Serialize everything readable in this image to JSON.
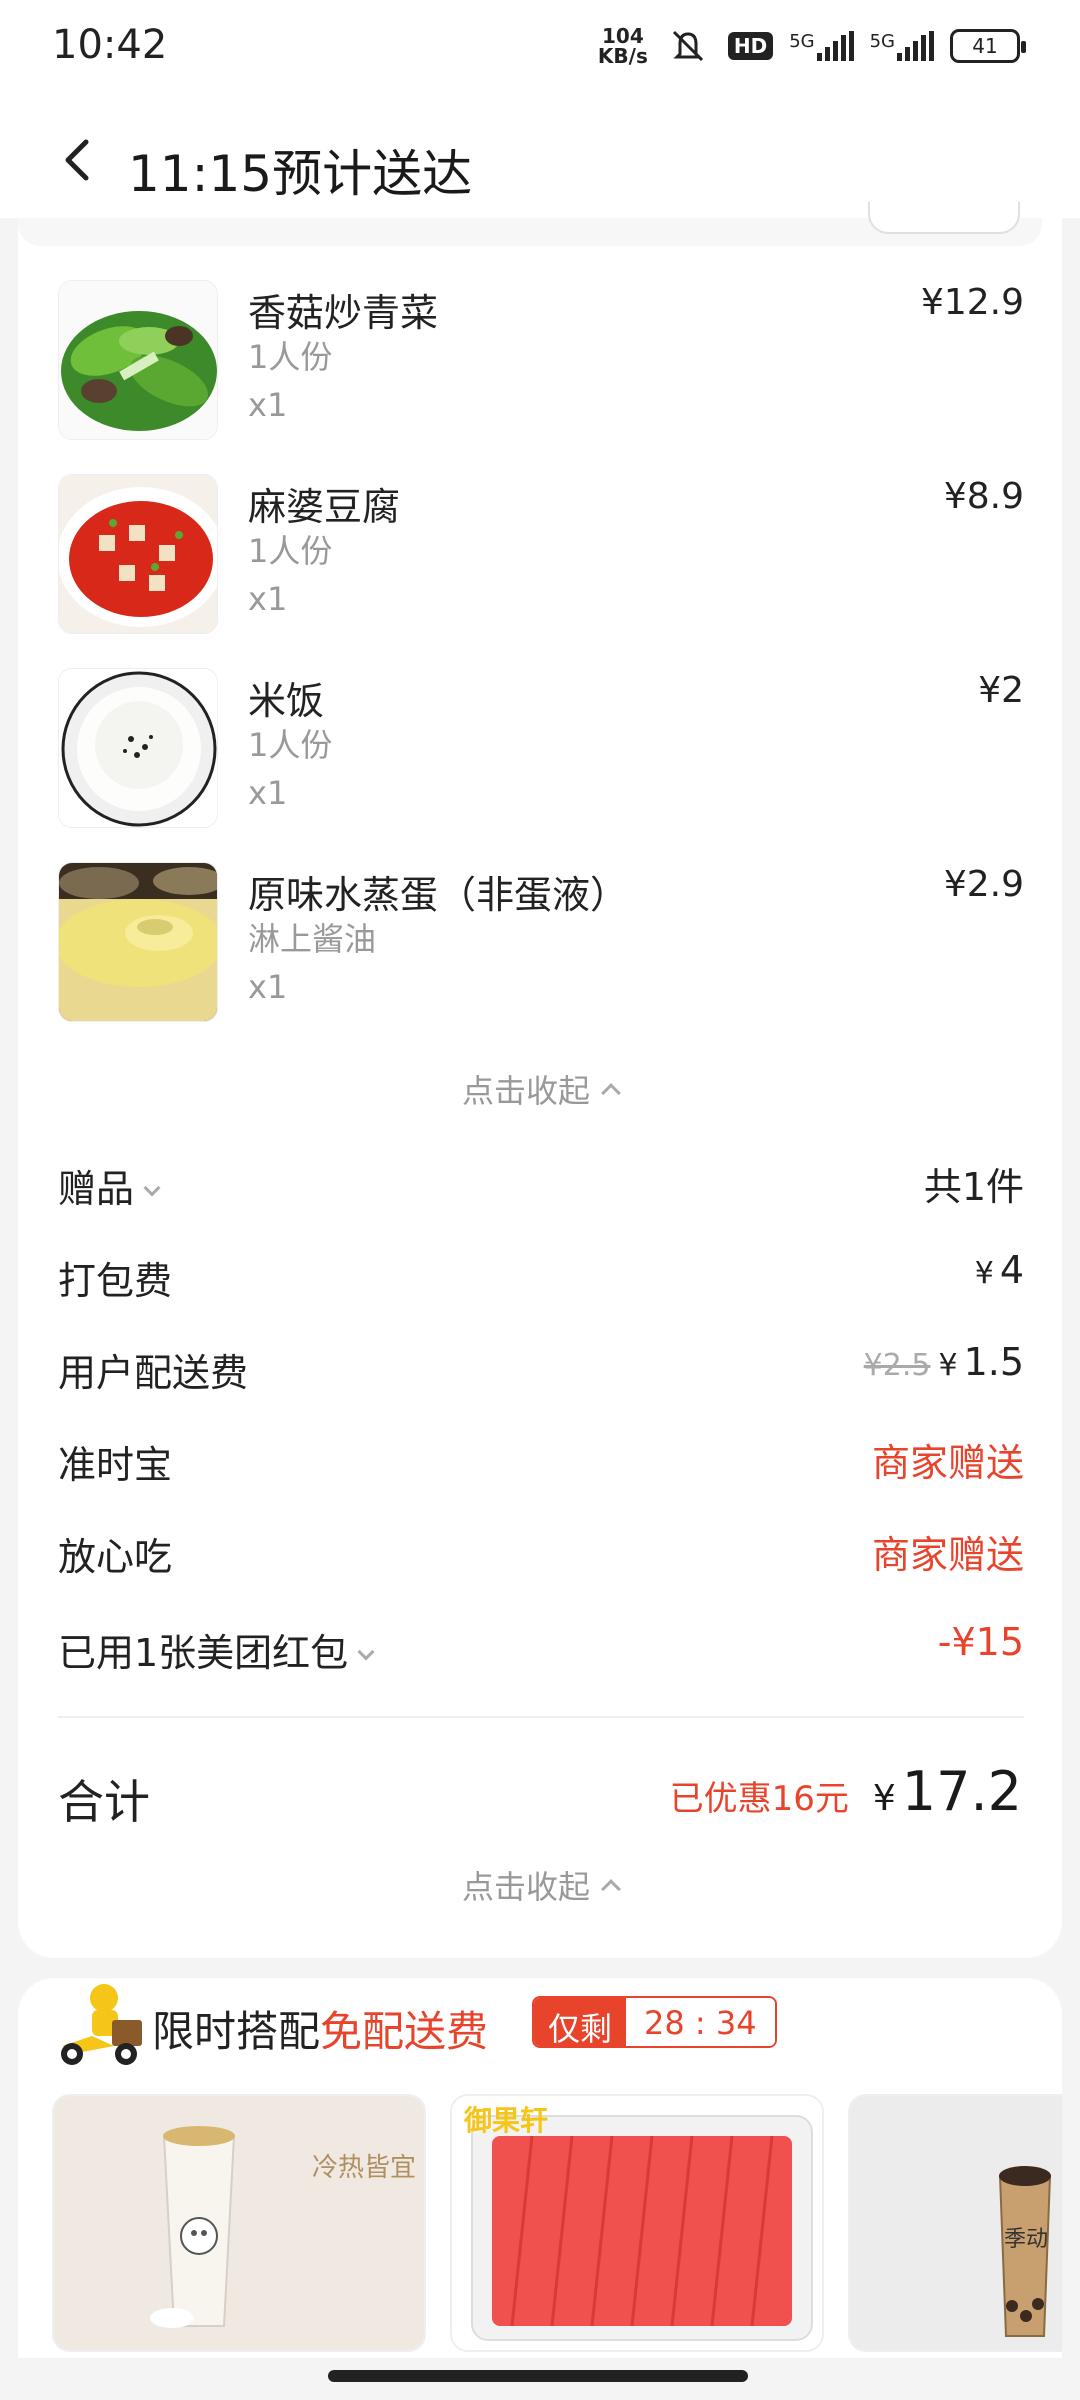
{
  "status_bar": {
    "time": "10:42",
    "net_speed_value": "104",
    "net_speed_unit": "KB/s",
    "hd_label": "HD",
    "signal1_label": "5G",
    "signal2_label": "5G",
    "battery": "41"
  },
  "header": {
    "title": "11:15预计送达"
  },
  "items": [
    {
      "name": "香菇炒青菜",
      "spec": "1人份",
      "qty": "x1",
      "price": "¥12.9"
    },
    {
      "name": "麻婆豆腐",
      "spec": "1人份",
      "qty": "x1",
      "price": "¥8.9"
    },
    {
      "name": "米饭",
      "spec": "1人份",
      "qty": "x1",
      "price": "¥2"
    },
    {
      "name": "原味水蒸蛋（非蛋液）",
      "spec": "淋上酱油",
      "qty": "x1",
      "price": "¥2.9"
    }
  ],
  "collapse_label": "点击收起",
  "fees": {
    "gift": {
      "label": "赠品",
      "value": "共1件"
    },
    "packing": {
      "label": "打包费",
      "yen": "¥",
      "value": "4"
    },
    "delivery": {
      "label": "用户配送费",
      "original": "¥2.5",
      "yen": "¥",
      "value": "1.5"
    },
    "on_time": {
      "label": "准时宝",
      "value": "商家赠送"
    },
    "safe_eat": {
      "label": "放心吃",
      "value": "商家赠送"
    },
    "red_packet": {
      "label": "已用1张美团红包",
      "value": "-¥15"
    }
  },
  "total": {
    "label": "合计",
    "saved": "已优惠16元",
    "yen": "¥",
    "value": "17.2"
  },
  "promo": {
    "title_prefix": "限时搭配",
    "title_highlight": "免配送费",
    "timer_label": "仅剩",
    "timer_count": "28 : 34",
    "products": [
      {
        "text": "冷热皆宜"
      },
      {
        "text": "御果轩"
      },
      {
        "text": "季动"
      }
    ]
  },
  "colors": {
    "accent_red": "#e8442c",
    "text_dark": "#222222",
    "text_gray": "#999999"
  }
}
